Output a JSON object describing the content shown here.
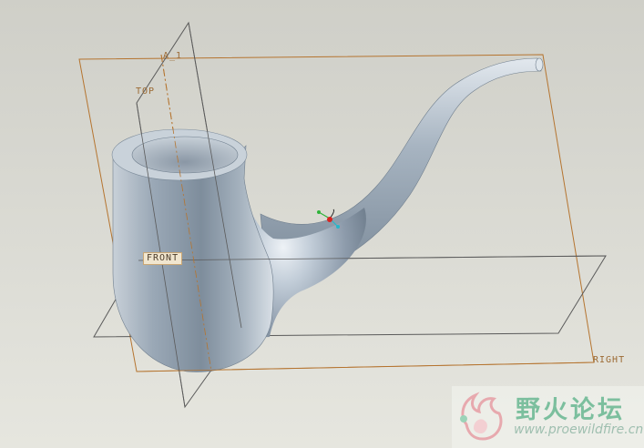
{
  "viewport": {
    "datum_planes": {
      "axis_label": "A_1",
      "top_label": "TOP",
      "front_label": "FRONT",
      "right_label": "RIGHT"
    },
    "model": "pipe-solid"
  },
  "watermark": {
    "title": "野火论坛",
    "url": "www.proewildfire.cn"
  },
  "colors": {
    "background": "#d6d6cf",
    "datum_plane": "#b5742f",
    "datum_plane_dark": "#555555",
    "model_surface": "#b9c5d1",
    "watermark_green": "#7cbf9e"
  }
}
